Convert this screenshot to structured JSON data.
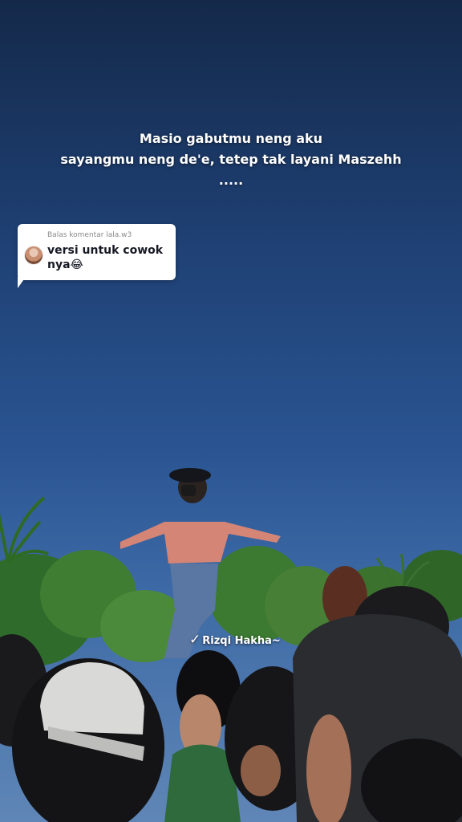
{
  "caption": {
    "line1": "Masio gabutmu neng aku",
    "line2": "sayangmu neng de'e, tetep tak layani Maszehh",
    "line3": "....."
  },
  "reply_card": {
    "header": "Balas komentar lala.w3",
    "text": "versi untuk cowok nya😂"
  },
  "watermark": {
    "check": "✓",
    "name": "Rizqi Hakha~"
  },
  "colors": {
    "sky_top": "#14294a",
    "sky_bottom": "#5f86b6",
    "bubble_bg": "#ffffff"
  }
}
